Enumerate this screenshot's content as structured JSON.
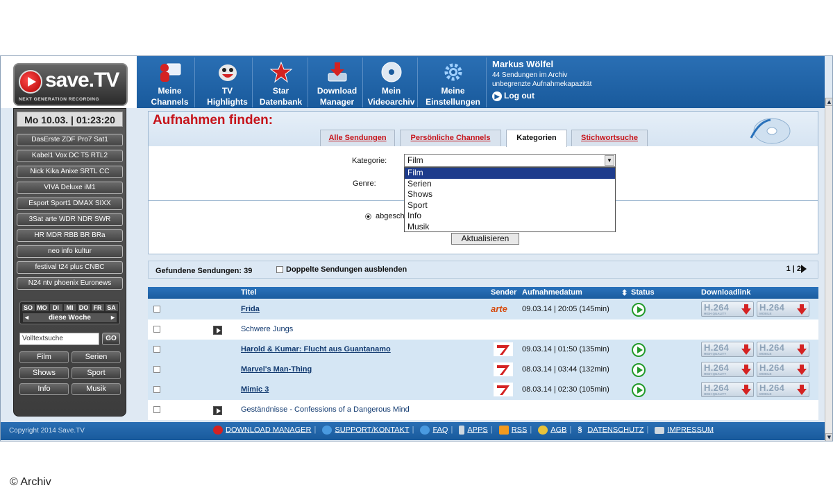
{
  "header": {
    "brand": "save.TV",
    "brand_tagline": "NEXT GENERATION RECORDING",
    "nav": [
      {
        "line1": "Meine",
        "line2": "Channels",
        "icon": "user-monitor-icon"
      },
      {
        "line1": "TV",
        "line2": "Highlights",
        "icon": "mascot-icon"
      },
      {
        "line1": "Star",
        "line2": "Datenbank",
        "icon": "star-icon"
      },
      {
        "line1": "Download",
        "line2": "Manager",
        "icon": "download-icon"
      },
      {
        "line1": "Mein",
        "line2": "Videoarchiv",
        "icon": "disc-icon"
      },
      {
        "line1": "Meine",
        "line2": "Einstellungen",
        "icon": "gear-icon"
      }
    ],
    "user": {
      "name": "Markus Wölfel",
      "archive": "44 Sendungen im Archiv",
      "capacity": "unbegrenzte Aufnahmekapazität",
      "logout": "Log out"
    }
  },
  "sidebar": {
    "clock": "Mo 10.03. | 01:23:20",
    "channel_groups": [
      "DasErste ZDF Pro7 Sat1",
      "Kabel1 Vox DC T5 RTL2",
      "Nick Kika Anixe SRTL CC",
      "VIVA Deluxe iM1",
      "Esport Sport1 DMAX SIXX",
      "3Sat arte WDR NDR SWR",
      "HR MDR RBB BR BRa",
      "neo info kultur",
      "festival t24 plus CNBC",
      "N24 ntv phoenix Euronews"
    ],
    "days": [
      "SO",
      "MO",
      "DI",
      "MI",
      "DO",
      "FR",
      "SA"
    ],
    "week_label": "diese Woche",
    "search_placeholder": "Volltextsuche",
    "go_label": "GO",
    "categories": [
      "Film",
      "Serien",
      "Shows",
      "Sport",
      "Info",
      "Musik"
    ]
  },
  "find": {
    "title": "Aufnahmen finden:",
    "tabs": [
      {
        "label": "Alle Sendungen",
        "active": false
      },
      {
        "label": "Persönliche Channels",
        "active": false
      },
      {
        "label": "Kategorien",
        "active": true
      },
      {
        "label": "Stichwortsuche",
        "active": false
      }
    ],
    "kategorie_label": "Kategorie:",
    "kategorie_value": "Film",
    "kategorie_options": [
      "Film",
      "Serien",
      "Shows",
      "Sport",
      "Info",
      "Musik"
    ],
    "genre_label": "Genre:",
    "radio_label": "abgeschl",
    "submit_label": "Aktualisieren"
  },
  "results": {
    "found_label": "Gefundene Sendungen: 39",
    "hide_dupes_label": "Doppelte Sendungen ausblenden",
    "pager": "1 | 2",
    "columns": [
      "Titel",
      "Sender",
      "Aufnahmedatum",
      "Status",
      "Downloadlink"
    ],
    "rows": [
      {
        "title": "Frida",
        "sender": "arte",
        "date": "09.03.14 | 20:05 (145min)",
        "linked": true
      },
      {
        "title": "Schwere Jungs",
        "sender": "",
        "date": "",
        "linked": false
      },
      {
        "title": "Harold & Kumar: Flucht aus Guantanamo",
        "sender": "pro7",
        "date": "09.03.14 | 01:50 (135min)",
        "linked": true
      },
      {
        "title": "Marvel's Man-Thing",
        "sender": "pro7",
        "date": "08.03.14 | 03:44 (132min)",
        "linked": true
      },
      {
        "title": "Mimic 3",
        "sender": "pro7",
        "date": "08.03.14 | 02:30 (105min)",
        "linked": true
      },
      {
        "title": "Geständnisse - Confessions of a Dangerous Mind",
        "sender": "",
        "date": "",
        "linked": false
      }
    ],
    "download_hq": {
      "codec": "H.264",
      "quality": "HIGH QUALITY"
    },
    "download_mobile": {
      "codec": "H.264",
      "quality": "MOBILE"
    }
  },
  "footer": {
    "copyright": "Copyright 2014 Save.TV",
    "links": [
      "DOWNLOAD MANAGER",
      "SUPPORT/KONTAKT",
      "FAQ",
      "APPS",
      "RSS",
      "AGB",
      "DATENSCHUTZ",
      "IMPRESSUM"
    ]
  },
  "credit": "© Archiv",
  "colors": {
    "brand_blue": "#195a9c",
    "accent_red": "#c6141b",
    "status_green": "#239a2a",
    "row_alt": "#d5e6f4"
  }
}
